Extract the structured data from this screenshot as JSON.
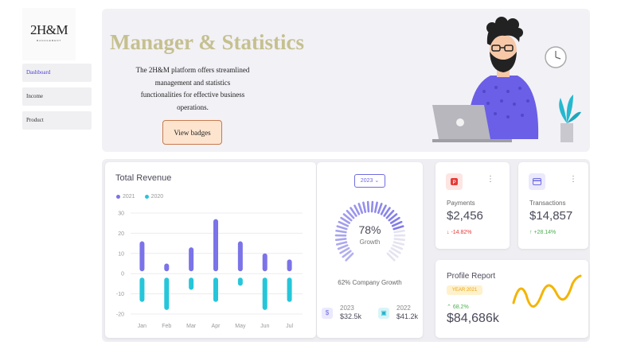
{
  "logo": {
    "wordmark": "2H&M",
    "subtitle": "MANAGEMENT"
  },
  "sidebar": {
    "items": [
      {
        "label": "Dashboard"
      },
      {
        "label": "Income"
      },
      {
        "label": "Product"
      }
    ]
  },
  "hero": {
    "title": "Manager & Statistics",
    "description": "The 2H&M platform offers streamlined management and statistics functionalities for effective business operations.",
    "button_label": "View badges"
  },
  "revenue": {
    "title": "Total Revenue",
    "legend": [
      {
        "name": "2021",
        "color": "#7b73e8"
      },
      {
        "name": "2020",
        "color": "#26c6da"
      }
    ]
  },
  "chart_data": {
    "type": "bar",
    "categories": [
      "Jan",
      "Feb",
      "Mar",
      "Apr",
      "May",
      "Jun",
      "Jul"
    ],
    "series": [
      {
        "name": "2021",
        "values": [
          16,
          5,
          13,
          27,
          16,
          10,
          7
        ]
      },
      {
        "name": "2020",
        "values": [
          -14,
          -18,
          -8,
          -14,
          -6,
          -18,
          -14
        ]
      }
    ],
    "ylim": [
      -20,
      30
    ],
    "yticks": [
      30,
      20,
      10,
      0,
      -10,
      -20
    ],
    "grid": true,
    "legend_position": "top-left"
  },
  "growth": {
    "year_select": "2023",
    "percent": "78%",
    "percent_label": "Growth",
    "value": 0.78,
    "company_growth": "62% Company Growth",
    "years": [
      {
        "year": "2023",
        "amount": "$32.5k",
        "icon": "dollar-icon"
      },
      {
        "year": "2022",
        "amount": "$41.2k",
        "icon": "wallet-icon"
      }
    ]
  },
  "payments": {
    "label": "Payments",
    "value": "$2,456",
    "change": "-14.82%",
    "icon": "paypal-icon"
  },
  "transactions": {
    "label": "Transactions",
    "value": "$14,857",
    "change": "+28.14%",
    "icon": "card-icon"
  },
  "profile": {
    "title": "Profile Report",
    "badge": "YEAR 2021",
    "change": "68.2%",
    "value": "$84,686k"
  },
  "colors": {
    "accent": "#6f6ce0",
    "series_2021": "#7b73e8",
    "series_2020": "#26c6da",
    "negative": "#e53935",
    "positive": "#4caf50",
    "profile_line": "#f4b400",
    "hero_title": "#c5c08f"
  }
}
